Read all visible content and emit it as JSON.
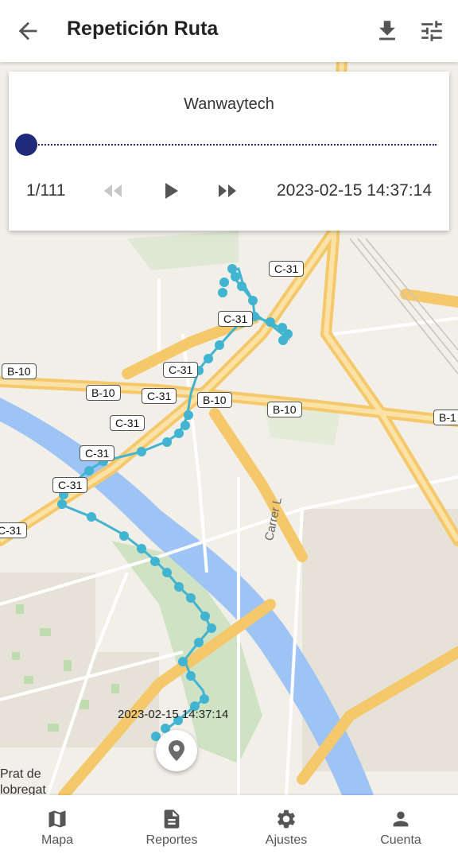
{
  "header": {
    "title": "Repetición Ruta",
    "back_icon": "arrow-back-icon",
    "download_icon": "download-icon",
    "settings_icon": "tune-icon"
  },
  "playback": {
    "device_name": "Wanwaytech",
    "counter": "1/111",
    "timestamp": "2023-02-15 14:37:14",
    "progress": 0.0
  },
  "map": {
    "road_labels": [
      "C-31",
      "C-31",
      "C-31",
      "B-10",
      "B-10",
      "C-31",
      "B-10",
      "B-10",
      "C-31",
      "C-31",
      "C-31",
      "B-1",
      "C-31"
    ],
    "street_label": "Carrer L",
    "area_label_1": "Prat de",
    "area_label_2": "lobregat",
    "point_tooltip": "2023-02-15 14:37:14",
    "route_color": "#40b4d0"
  },
  "nav": {
    "items": [
      {
        "label": "Mapa",
        "icon": "map-icon"
      },
      {
        "label": "Reportes",
        "icon": "document-icon"
      },
      {
        "label": "Ajustes",
        "icon": "gear-icon"
      },
      {
        "label": "Cuenta",
        "icon": "person-icon"
      }
    ]
  }
}
